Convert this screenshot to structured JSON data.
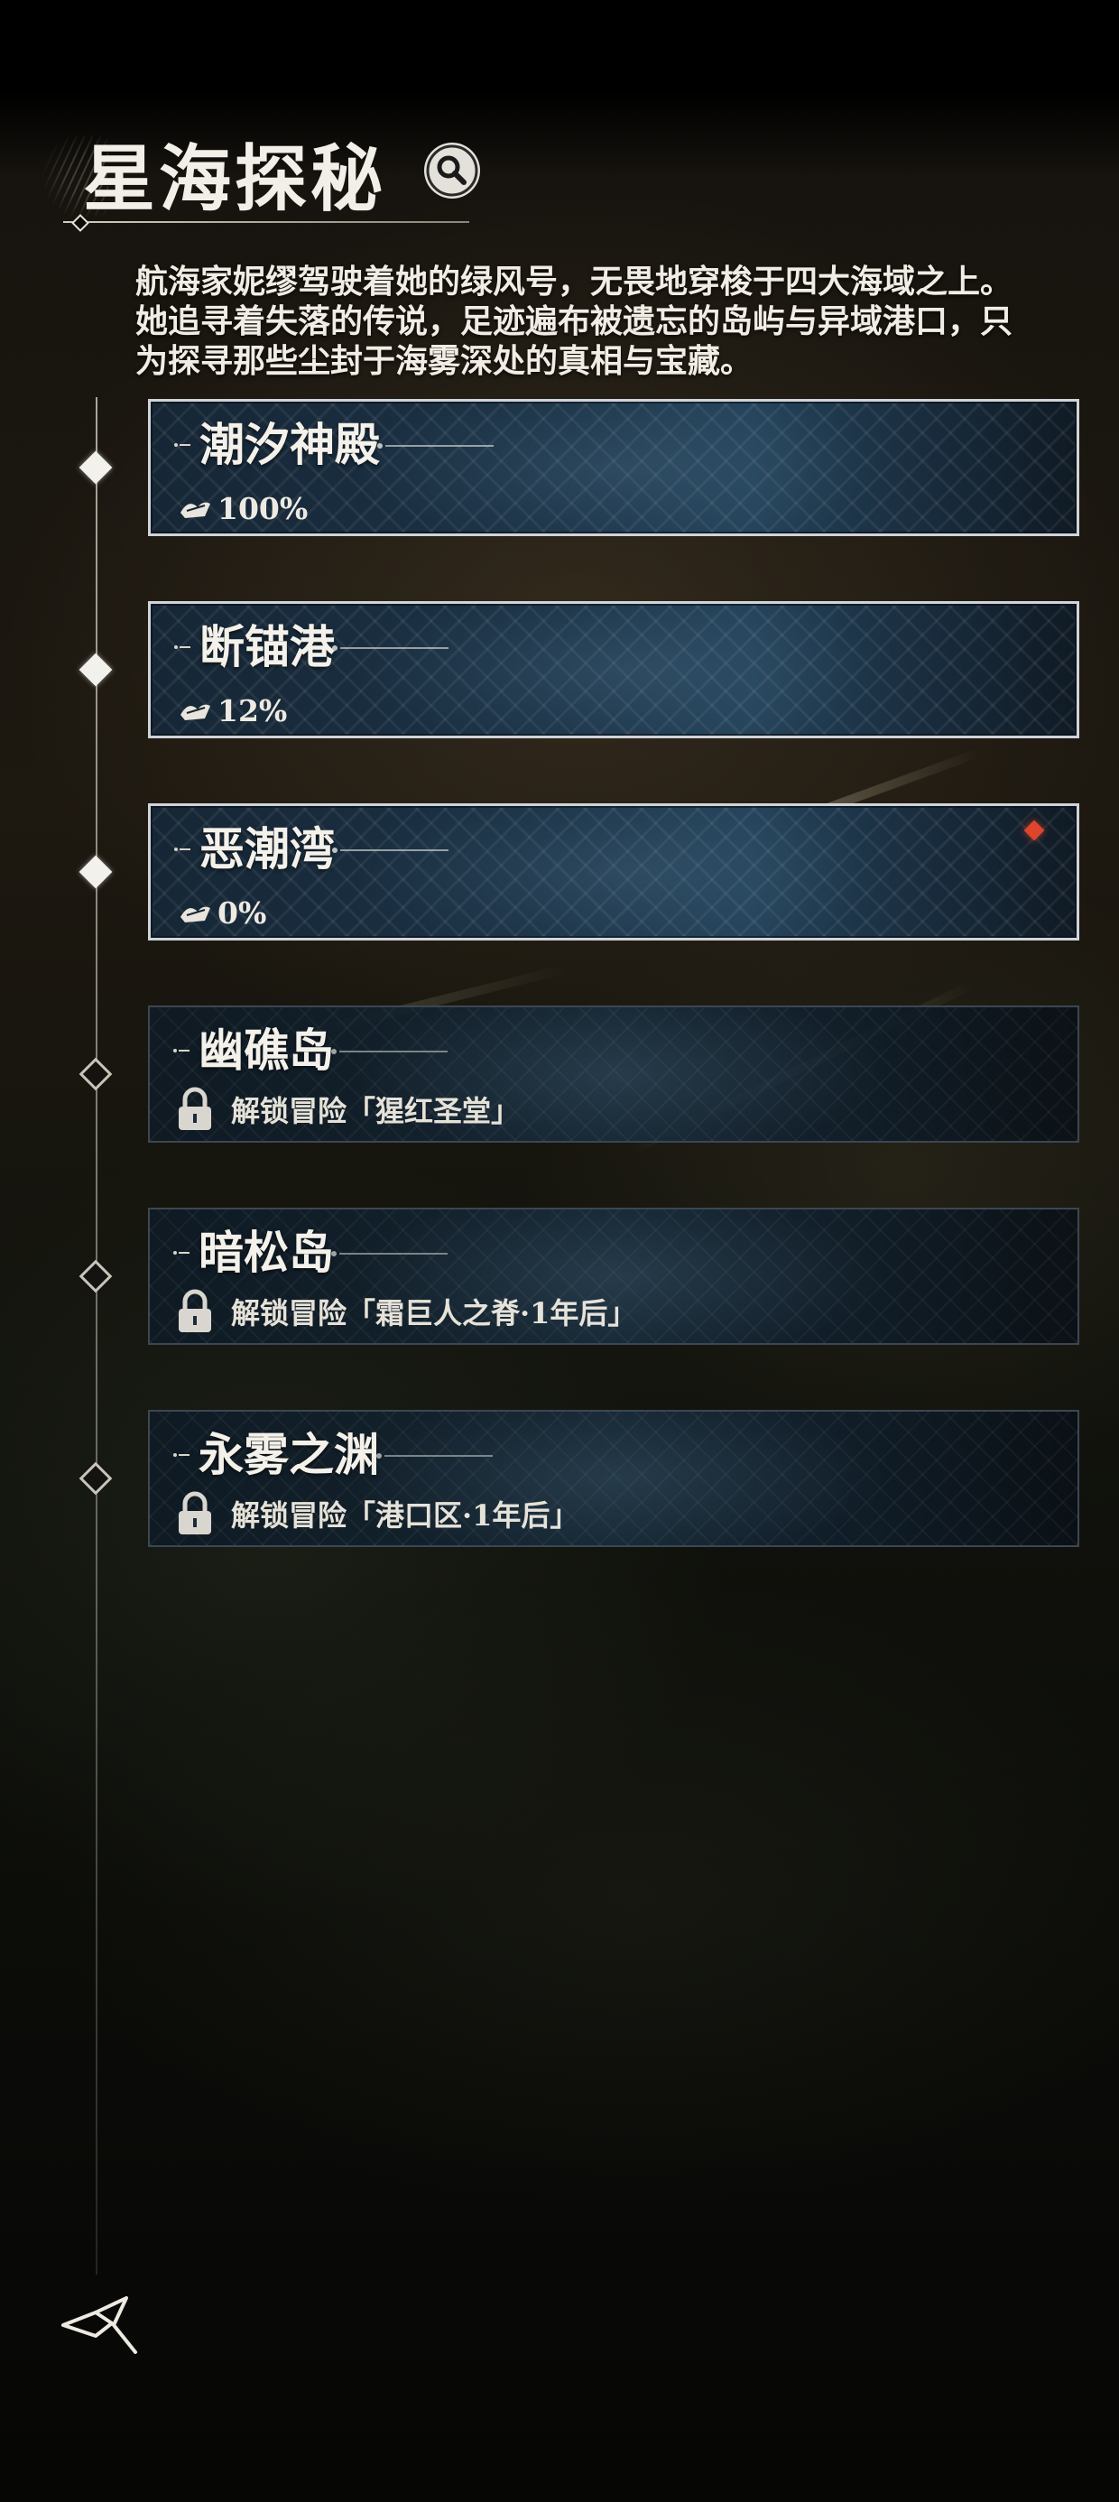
{
  "header": {
    "title": "星海探秘",
    "search_icon": "search-icon"
  },
  "description": "航海家妮缪驾驶着她的绿风号，无畏地穿梭于四大海域之上。她追寻着失落的传说，足迹遍布被遗忘的岛屿与异域港口，只为探寻那些尘封于海雾深处的真相与宝藏。",
  "regions": [
    {
      "name": "潮汐神殿",
      "status": "unlocked",
      "progress": "100%",
      "progress_value": 100
    },
    {
      "name": "断锚港",
      "status": "unlocked",
      "progress": "12%",
      "progress_value": 12
    },
    {
      "name": "恶潮湾",
      "status": "unlocked",
      "progress": "0%",
      "progress_value": 0,
      "has_new_badge": true
    },
    {
      "name": "幽礁岛",
      "status": "locked",
      "unlock_text": "解锁冒险「猩红圣堂」"
    },
    {
      "name": "暗松岛",
      "status": "locked",
      "unlock_text": "解锁冒险「霜巨人之脊·1年后」"
    },
    {
      "name": "永雾之渊",
      "status": "locked",
      "unlock_text": "解锁冒险「港口区·1年后」"
    }
  ],
  "icons": {
    "progress": "exploration-progress-icon",
    "lock": "lock-icon",
    "back": "back-arrow-icon"
  },
  "colors": {
    "accent_badge": "#e0452b",
    "card_border_unlocked": "#cfd4da",
    "card_fill": "#1b3347"
  }
}
